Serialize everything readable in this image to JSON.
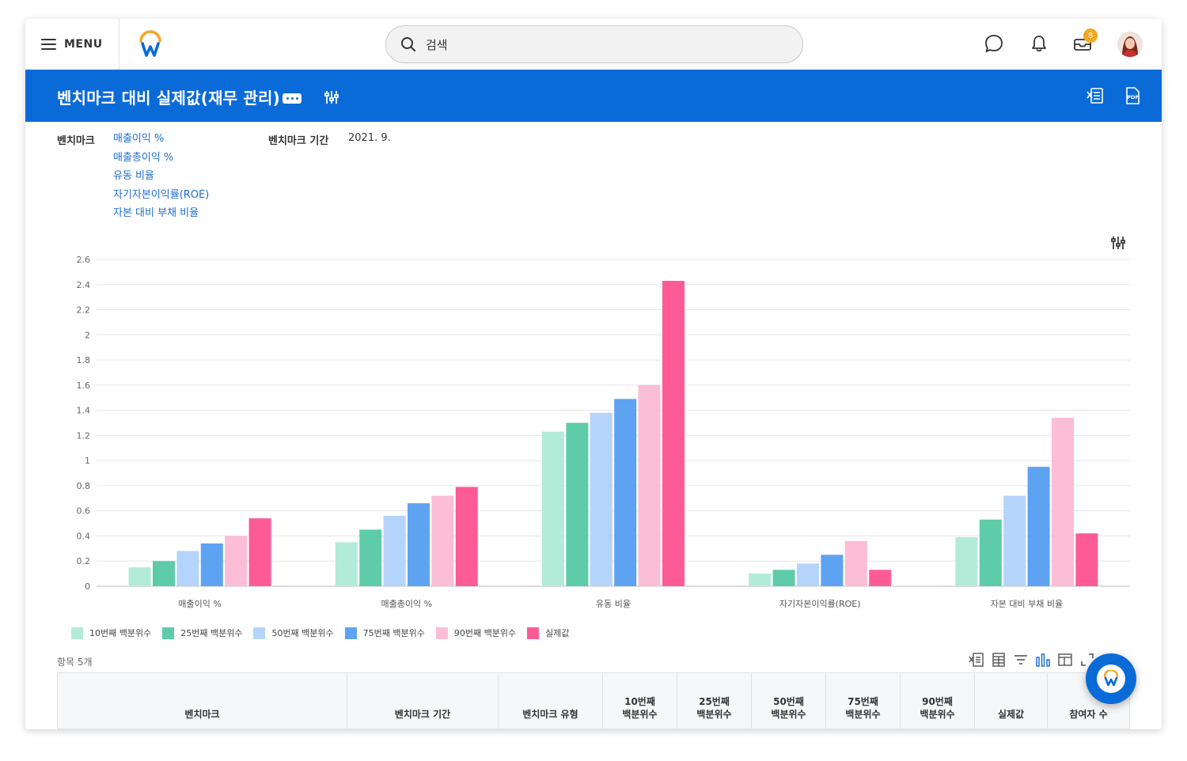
{
  "nav": {
    "menu_label": "MENU",
    "search_placeholder": "검색",
    "inbox_badge": "8"
  },
  "header": {
    "title": "벤치마크 대비 실제값(재무 관리)"
  },
  "info": {
    "benchmark_label": "벤치마크",
    "benchmarks": [
      "매출이익 %",
      "매출총이익 %",
      "유동 비율",
      "자기자본이익률(ROE)",
      "자본 대비 부채 비율"
    ],
    "period_label": "벤치마크 기간",
    "period_value": "2021. 9."
  },
  "chart_data": {
    "type": "bar",
    "categories": [
      "매출이익 %",
      "매출총이익 %",
      "유동 비율",
      "자기자본이익률(ROE)",
      "자본 대비 부채 비율"
    ],
    "series": [
      {
        "name": "10번째 백분위수",
        "color": "#b3ebd9",
        "values": [
          0.15,
          0.35,
          1.23,
          0.1,
          0.39
        ]
      },
      {
        "name": "25번째 백분위수",
        "color": "#5ecca8",
        "values": [
          0.2,
          0.45,
          1.3,
          0.13,
          0.53
        ]
      },
      {
        "name": "50번째 백분위수",
        "color": "#b4d4fb",
        "values": [
          0.28,
          0.56,
          1.38,
          0.18,
          0.72
        ]
      },
      {
        "name": "75번째 백분위수",
        "color": "#5ea3f2",
        "values": [
          0.34,
          0.66,
          1.49,
          0.25,
          0.95
        ]
      },
      {
        "name": "90번째 백분위수",
        "color": "#fcbdd6",
        "values": [
          0.4,
          0.72,
          1.6,
          0.36,
          1.34
        ]
      },
      {
        "name": "실제값",
        "color": "#fc5b96",
        "values": [
          0.54,
          0.79,
          2.43,
          0.13,
          0.42
        ]
      }
    ],
    "ylim": [
      0,
      2.6
    ],
    "yticks": [
      "0",
      "0.2",
      "0.4",
      "0.6",
      "0.8",
      "1",
      "1.2",
      "1.4",
      "1.6",
      "1.8",
      "2",
      "2.2",
      "2.4",
      "2.6"
    ],
    "grid": true,
    "legend_position": "bottom-left"
  },
  "table": {
    "count_label": "항목 5개",
    "columns": [
      "벤치마크",
      "벤치마크 기간",
      "벤치마크 유형",
      "10번째\n백분위수",
      "25번째\n백분위수",
      "50번째\n백분위수",
      "75번째\n백분위수",
      "90번째\n백분위수",
      "실제값",
      "참여자 수"
    ]
  }
}
